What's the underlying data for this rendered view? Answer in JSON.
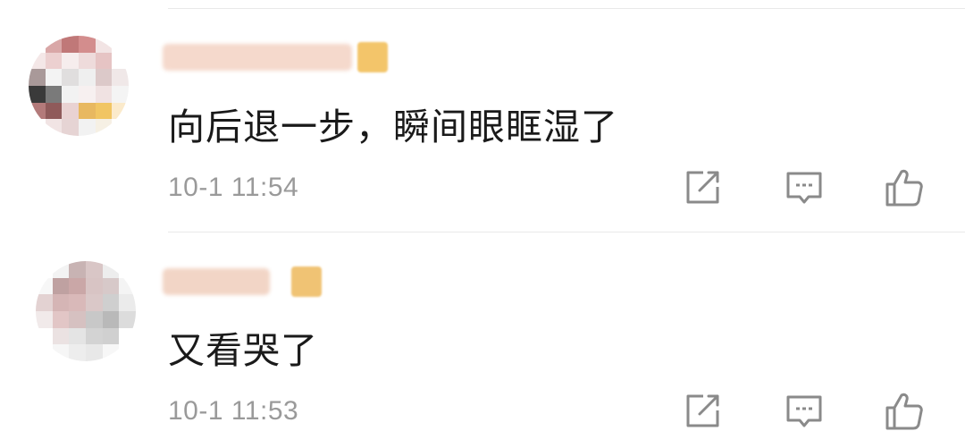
{
  "comments": [
    {
      "username": "",
      "text": "向后退一步，瞬间眼眶湿了",
      "time": "10-1 11:54",
      "avatar_colors": [
        "#ffffff",
        "#d9a7a7",
        "#c07878",
        "#d38d8d",
        "#f2e4e4",
        "#ffffff",
        "#f4e7e7",
        "#ecd0d0",
        "#f6eded",
        "#eedbdb",
        "#e6c4c4",
        "#ffffff",
        "#a99999",
        "#f3f3f3",
        "#e0dede",
        "#efefef",
        "#dcc9c9",
        "#f0e8e8",
        "#3a3a3a",
        "#7a7a7a",
        "#f2f2f2",
        "#f7f0f0",
        "#f0e2e2",
        "#f4f4f4",
        "#b37a7a",
        "#8f5a5a",
        "#e9d2d2",
        "#e8b860",
        "#f1c563",
        "#fbeacb",
        "#ffffff",
        "#f1e4e4",
        "#e6d4d4",
        "#f2f2f2",
        "#f6f0e4",
        "#ffffff"
      ],
      "name_color": "#f5d9cc",
      "badge_color": "#f3c56a"
    },
    {
      "username": "",
      "text": "又看哭了",
      "time": "10-1 11:53",
      "avatar_colors": [
        "#ffffff",
        "#f3f3f3",
        "#c8b3b3",
        "#d9c6c6",
        "#ededed",
        "#ffffff",
        "#f7f7f7",
        "#bfa1a1",
        "#caa7a7",
        "#d8c4c4",
        "#d7c9c9",
        "#f4f4f4",
        "#e3d2d2",
        "#d5b5b5",
        "#d9b9b9",
        "#dac8c8",
        "#cfcfcf",
        "#ebebeb",
        "#f1eaea",
        "#e2c6c6",
        "#d6c1c1",
        "#c8c8c8",
        "#b9b9b9",
        "#dcdcdc",
        "#ffffff",
        "#ebe2e2",
        "#e4e4e4",
        "#d3d3d3",
        "#d0d0d0",
        "#ffffff",
        "#ffffff",
        "#f6f6f6",
        "#ededed",
        "#e8e8e8",
        "#f7f7f7",
        "#ffffff"
      ],
      "name_color": "#f2d5c6",
      "badge_color": "#f0c374"
    }
  ],
  "icons": {
    "share": "share-icon",
    "reply": "comment-icon",
    "like": "thumbs-up-icon",
    "color": "#8a8a8a"
  }
}
